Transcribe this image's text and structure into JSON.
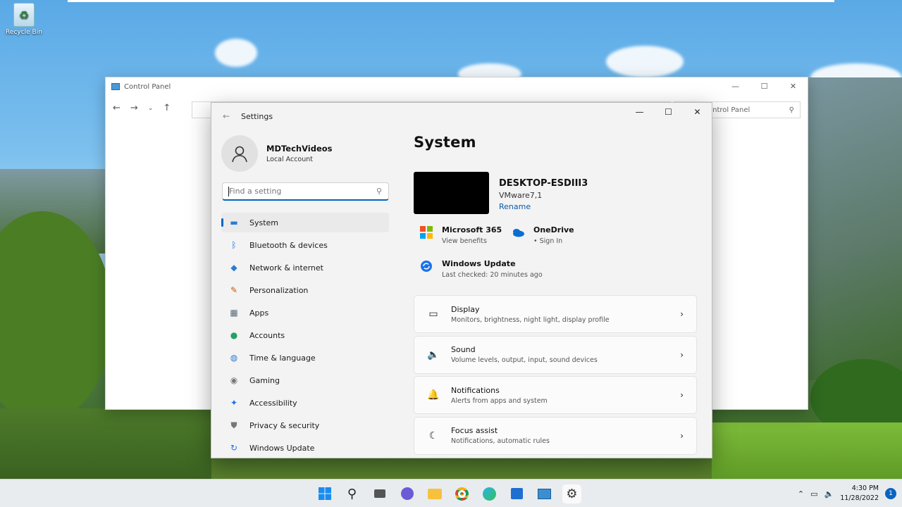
{
  "desktop": {
    "recycle_bin_label": "Recycle Bin"
  },
  "control_panel": {
    "title": "Control Panel",
    "search_placeholder": "ontrol Panel"
  },
  "settings": {
    "window_title": "Settings",
    "user": {
      "name": "MDTechVideos",
      "account_type": "Local Account"
    },
    "search_placeholder": "Find a setting",
    "nav_items": [
      {
        "label": "System",
        "icon": "system-icon",
        "color": "#2b7cd3"
      },
      {
        "label": "Bluetooth & devices",
        "icon": "bluetooth-icon",
        "color": "#1a73e8"
      },
      {
        "label": "Network & internet",
        "icon": "wifi-icon",
        "color": "#2b7cd3"
      },
      {
        "label": "Personalization",
        "icon": "brush-icon",
        "color": "#d35400"
      },
      {
        "label": "Apps",
        "icon": "apps-icon",
        "color": "#5a6a7a"
      },
      {
        "label": "Accounts",
        "icon": "accounts-icon",
        "color": "#21a366"
      },
      {
        "label": "Time & language",
        "icon": "globe-icon",
        "color": "#2b7cd3"
      },
      {
        "label": "Gaming",
        "icon": "controller-icon",
        "color": "#777777"
      },
      {
        "label": "Accessibility",
        "icon": "accessibility-icon",
        "color": "#1a73e8"
      },
      {
        "label": "Privacy & security",
        "icon": "shield-icon",
        "color": "#777777"
      },
      {
        "label": "Windows Update",
        "icon": "update-icon",
        "color": "#1a73e8"
      }
    ],
    "page_title": "System",
    "device": {
      "name": "DESKTOP-ESDIII3",
      "model": "VMware7,1",
      "rename_label": "Rename"
    },
    "tiles": {
      "m365_title": "Microsoft 365",
      "m365_sub": "View benefits",
      "onedrive_title": "OneDrive",
      "onedrive_sub": "• Sign In",
      "update_title": "Windows Update",
      "update_sub": "Last checked: 20 minutes ago"
    },
    "cards": [
      {
        "title": "Display",
        "subtitle": "Monitors, brightness, night light, display profile",
        "icon": "monitor-icon"
      },
      {
        "title": "Sound",
        "subtitle": "Volume levels, output, input, sound devices",
        "icon": "speaker-icon"
      },
      {
        "title": "Notifications",
        "subtitle": "Alerts from apps and system",
        "icon": "bell-icon"
      },
      {
        "title": "Focus assist",
        "subtitle": "Notifications, automatic rules",
        "icon": "moon-icon"
      }
    ]
  },
  "taskbar": {
    "time": "4:30 PM",
    "date": "11/28/2022",
    "notification_count": "1"
  }
}
